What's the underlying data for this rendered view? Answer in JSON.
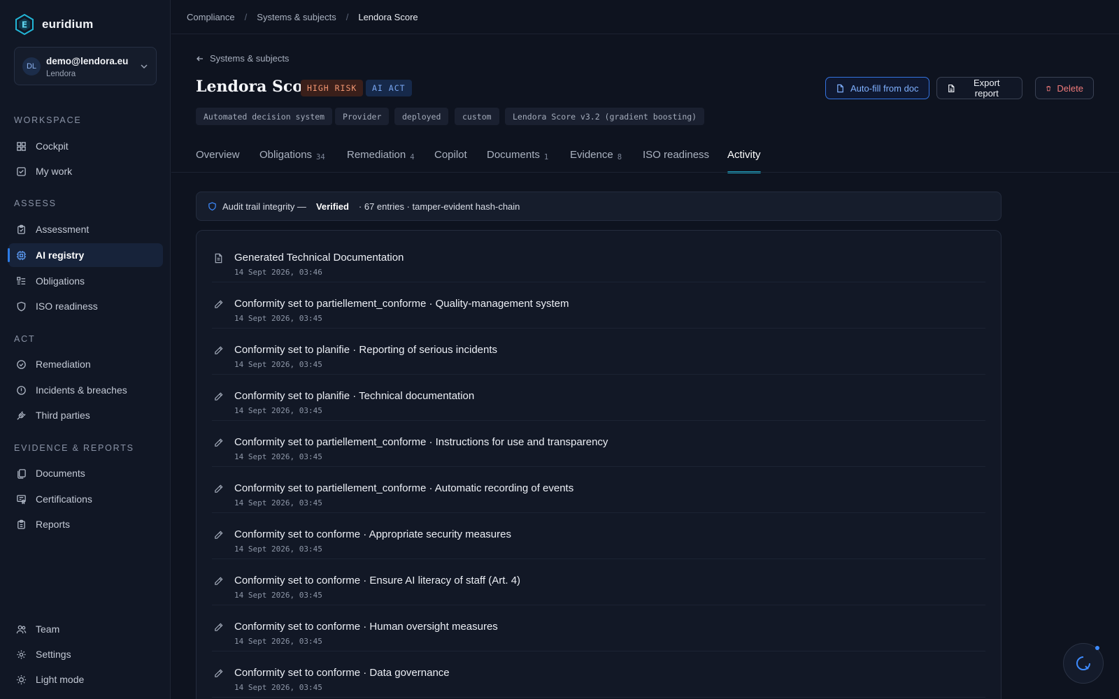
{
  "brand": {
    "name": "euridium"
  },
  "account": {
    "initials": "DL",
    "email": "demo@lendora.eu",
    "org": "Lendora"
  },
  "sidebar": {
    "sections": [
      {
        "title": "WORKSPACE",
        "items": [
          {
            "label": "Cockpit",
            "icon": "grid-icon"
          },
          {
            "label": "My work",
            "icon": "check-square-icon"
          }
        ]
      },
      {
        "title": "ASSESS",
        "items": [
          {
            "label": "Assessment",
            "icon": "clipboard-icon"
          },
          {
            "label": "AI registry",
            "icon": "chip-icon",
            "active": true
          },
          {
            "label": "Obligations",
            "icon": "list-icon"
          },
          {
            "label": "ISO readiness",
            "icon": "shield-icon"
          }
        ]
      },
      {
        "title": "ACT",
        "items": [
          {
            "label": "Remediation",
            "icon": "check-circle-icon"
          },
          {
            "label": "Incidents & breaches",
            "icon": "alert-circle-icon"
          },
          {
            "label": "Third parties",
            "icon": "plug-icon"
          }
        ]
      },
      {
        "title": "EVIDENCE & REPORTS",
        "items": [
          {
            "label": "Documents",
            "icon": "files-icon"
          },
          {
            "label": "Certifications",
            "icon": "certificate-icon"
          },
          {
            "label": "Reports",
            "icon": "report-icon"
          }
        ]
      }
    ],
    "bottom": [
      {
        "label": "Team",
        "icon": "users-icon"
      },
      {
        "label": "Settings",
        "icon": "gear-icon"
      },
      {
        "label": "Light mode",
        "icon": "sun-icon"
      }
    ]
  },
  "breadcrumb": [
    "Compliance",
    "Systems & subjects",
    "Lendora Score"
  ],
  "back_label": "Systems & subjects",
  "system": {
    "title": "Lendora Score",
    "badges": [
      "HIGH RISK",
      "AI ACT"
    ],
    "tags": [
      "Automated decision system",
      "Provider",
      "deployed",
      "custom",
      "Lendora Score v3.2 (gradient boosting)"
    ]
  },
  "actions": {
    "autofill": "Auto-fill from doc",
    "export": "Export report",
    "delete": "Delete"
  },
  "tabs": [
    {
      "label": "Overview",
      "count": ""
    },
    {
      "label": "Obligations",
      "count": "34"
    },
    {
      "label": "Remediation",
      "count": "4"
    },
    {
      "label": "Copilot",
      "count": ""
    },
    {
      "label": "Documents",
      "count": "1"
    },
    {
      "label": "Evidence",
      "count": "8"
    },
    {
      "label": "ISO readiness",
      "count": ""
    },
    {
      "label": "Activity",
      "count": "",
      "active": true
    }
  ],
  "integrity": {
    "prefix": "Audit trail integrity —",
    "status": "Verified",
    "suffix": "· 67 entries · tamper-evident hash-chain"
  },
  "activity": [
    {
      "icon": "document-icon",
      "title": "Generated Technical Documentation",
      "time": "14 Sept 2026, 03:46"
    },
    {
      "icon": "pencil-icon",
      "title": "Conformity set to partiellement_conforme · Quality-management system",
      "time": "14 Sept 2026, 03:45"
    },
    {
      "icon": "pencil-icon",
      "title": "Conformity set to planifie · Reporting of serious incidents",
      "time": "14 Sept 2026, 03:45"
    },
    {
      "icon": "pencil-icon",
      "title": "Conformity set to planifie · Technical documentation",
      "time": "14 Sept 2026, 03:45"
    },
    {
      "icon": "pencil-icon",
      "title": "Conformity set to partiellement_conforme · Instructions for use and transparency",
      "time": "14 Sept 2026, 03:45"
    },
    {
      "icon": "pencil-icon",
      "title": "Conformity set to partiellement_conforme · Automatic recording of events",
      "time": "14 Sept 2026, 03:45"
    },
    {
      "icon": "pencil-icon",
      "title": "Conformity set to conforme · Appropriate security measures",
      "time": "14 Sept 2026, 03:45"
    },
    {
      "icon": "pencil-icon",
      "title": "Conformity set to conforme · Ensure AI literacy of staff (Art. 4)",
      "time": "14 Sept 2026, 03:45"
    },
    {
      "icon": "pencil-icon",
      "title": "Conformity set to conforme · Human oversight measures",
      "time": "14 Sept 2026, 03:45"
    },
    {
      "icon": "pencil-icon",
      "title": "Conformity set to conforme · Data governance",
      "time": "14 Sept 2026, 03:45"
    }
  ]
}
